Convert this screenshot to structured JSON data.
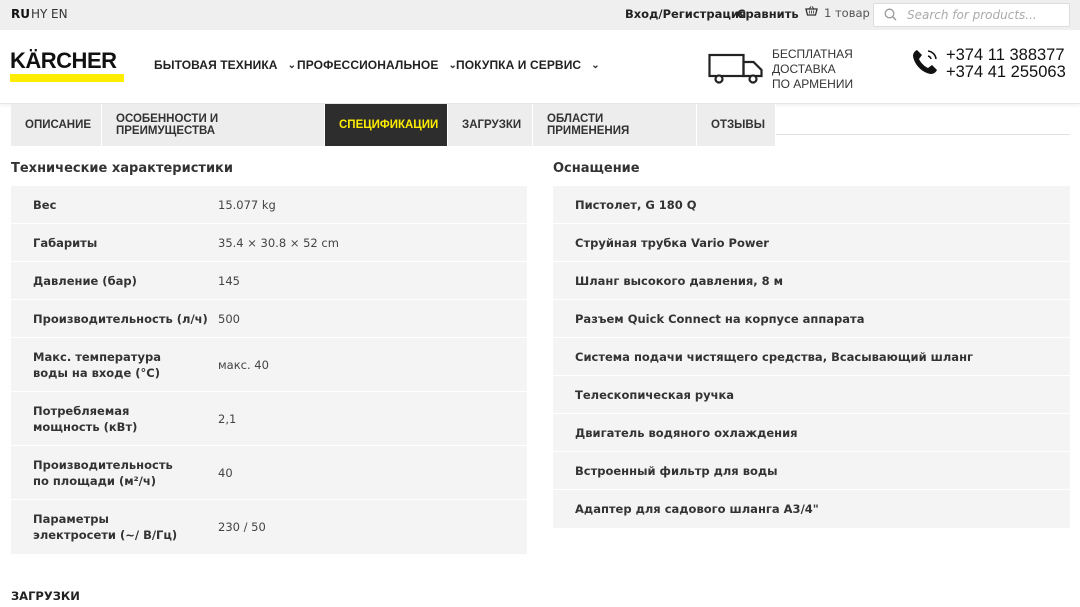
{
  "topbar": {
    "languages": [
      "RU",
      "HY",
      "EN"
    ],
    "login_label": "Вход/Регистрация",
    "compare_label": "Сравнить",
    "cart_label": "1 товар",
    "search_placeholder": "Search for products..."
  },
  "header": {
    "logo_text": "KÄRCHER",
    "nav": [
      "БЫТОВАЯ ТЕХНИКА",
      "ПРОФЕССИОНАЛЬНОЕ",
      "ПОКУПКА И СЕРВИС"
    ],
    "delivery_line1": "БЕСПЛАТНАЯ ДОСТАВКА",
    "delivery_line2": "ПО АРМЕНИИ",
    "phone1": "+374 11 388377",
    "phone2": "+374 41 255063"
  },
  "tabs": [
    "ОПИСАНИЕ",
    "ОСОБЕННОСТИ И ПРЕИМУЩЕСТВА",
    "СПЕЦИФИКАЦИИ",
    "ЗАГРУЗКИ",
    "ОБЛАСТИ ПРИМЕНЕНИЯ",
    "ОТЗЫВЫ"
  ],
  "active_tab": "СПЕЦИФИКАЦИИ",
  "specs": {
    "title": "Технические характеристики",
    "rows": [
      {
        "label": "Вес",
        "value": "15.077 kg"
      },
      {
        "label": "Габариты",
        "value": "35.4 × 30.8 × 52 cm"
      },
      {
        "label": "Давление (бар)",
        "value": "145"
      },
      {
        "label": "Производительность (л/ч)",
        "value": "500"
      },
      {
        "label": "Макс. температура воды на входе (°C)",
        "value": "макс. 40"
      },
      {
        "label": "Потребляемая мощность (кВт)",
        "value": "2,1"
      },
      {
        "label": "Производительность по площади (м²/ч)",
        "value": "40"
      },
      {
        "label": "Параметры электросети (~/ В/Гц)",
        "value": "230 / 50"
      }
    ]
  },
  "equipment": {
    "title": "Оснащение",
    "items": [
      "Пистолет, G 180 Q",
      "Струйная трубка Vario Power",
      "Шланг высокого давления, 8 м",
      "Разъем Quick Connect на корпусе аппарата",
      "Система подачи чистящего средства, Всасывающий шланг",
      "Телескопическая ручка",
      "Двигатель водяного охлаждения",
      "Встроенный фильтр для воды",
      "Адаптер для садового шланга A3/4\""
    ]
  },
  "downloads_title": "ЗАГРУЗКИ",
  "colors": {
    "brand_yellow": "#ffed00",
    "active_tab_bg": "#2d2d2d",
    "tab_bg": "#ededed",
    "table_bg": "#f4f4f4"
  }
}
